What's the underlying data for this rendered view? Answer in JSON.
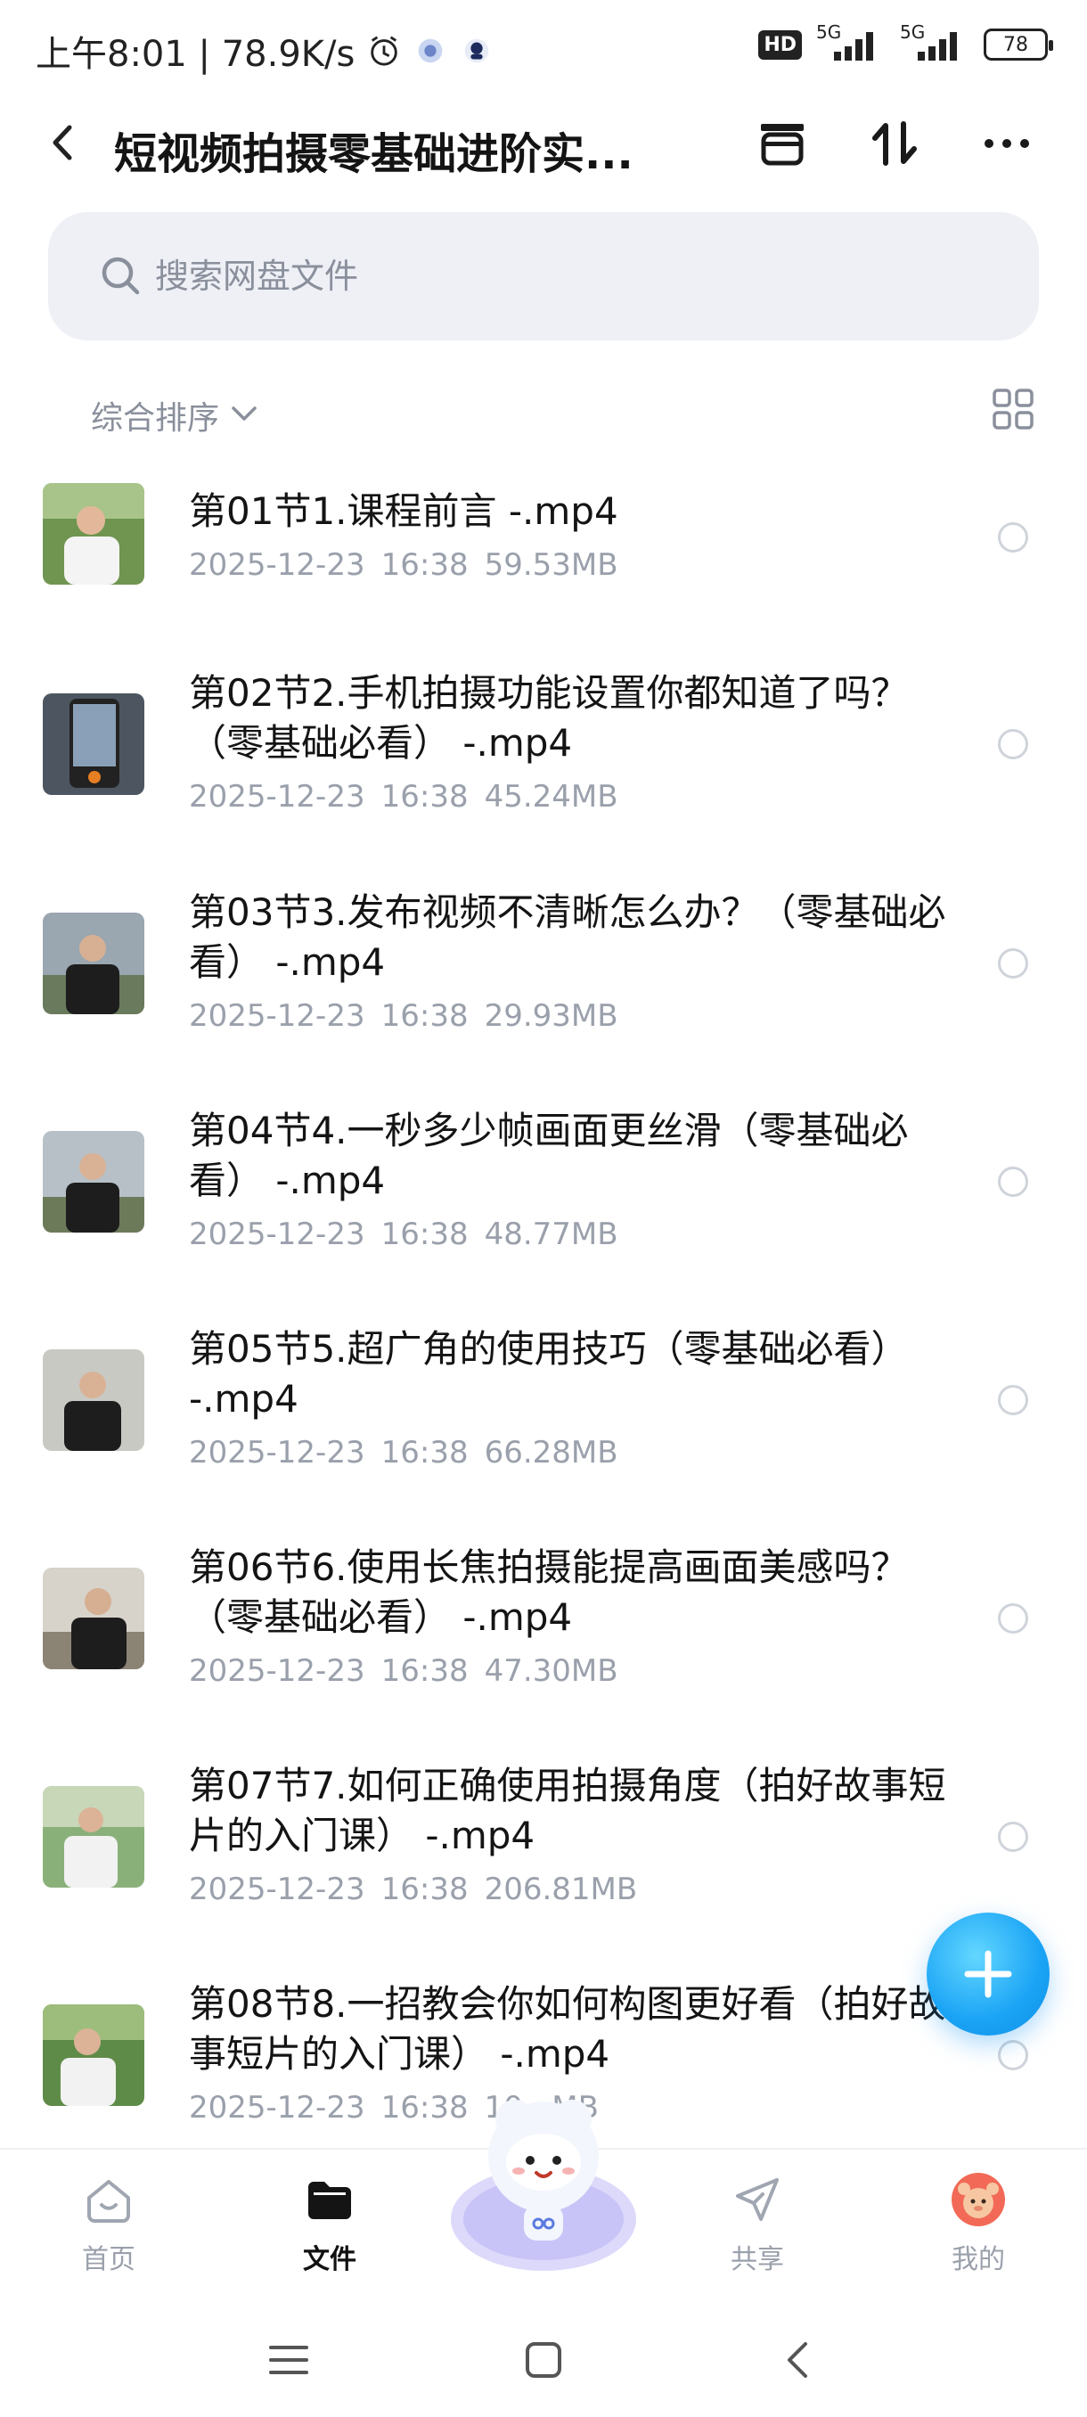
{
  "status_bar": {
    "time_and_speed": "上午8:01 | 78.9K/s",
    "hd_label": "HD",
    "network_1": "5G",
    "network_2": "5G",
    "battery": "78"
  },
  "header": {
    "title": "短视频拍摄零基础进阶实...",
    "back_icon": "chevron-left-icon",
    "archive_icon": "archive-box-icon",
    "sort_icon": "sort-arrows-icon",
    "more_icon": "more-dots-icon"
  },
  "search": {
    "placeholder": "搜索网盘文件"
  },
  "sort": {
    "label": "综合排序"
  },
  "files": [
    {
      "name": "第01节1.课程前言 -.mp4",
      "date": "2025-12-23",
      "time": "16:38",
      "size": "59.53MB"
    },
    {
      "name": "第02节2.手机拍摄功能设置你都知道了吗？（零基础必看） -.mp4",
      "date": "2025-12-23",
      "time": "16:38",
      "size": "45.24MB"
    },
    {
      "name": "第03节3.发布视频不清晰怎么办？（零基础必看） -.mp4",
      "date": "2025-12-23",
      "time": "16:38",
      "size": "29.93MB"
    },
    {
      "name": "第04节4.一秒多少帧画面更丝滑（零基础必看） -.mp4",
      "date": "2025-12-23",
      "time": "16:38",
      "size": "48.77MB"
    },
    {
      "name": "第05节5.超广角的使用技巧（零基础必看） -.mp4",
      "date": "2025-12-23",
      "time": "16:38",
      "size": "66.28MB"
    },
    {
      "name": "第06节6.使用长焦拍摄能提高画面美感吗？（零基础必看） -.mp4",
      "date": "2025-12-23",
      "time": "16:38",
      "size": "47.30MB"
    },
    {
      "name": "第07节7.如何正确使用拍摄角度（拍好故事短片的入门课） -.mp4",
      "date": "2025-12-23",
      "time": "16:38",
      "size": "206.81MB"
    },
    {
      "name": "第08节8.一招教会你如何构图更好看（拍好故事短片的入门课） -.mp4",
      "date": "2025-12-23",
      "time": "16:38",
      "size": "10...MB"
    }
  ],
  "tabs": [
    {
      "label": "首页",
      "icon": "home-icon"
    },
    {
      "label": "文件",
      "icon": "folder-icon"
    },
    {
      "label": "共享",
      "icon": "paper-plane-icon"
    },
    {
      "label": "我的",
      "icon": "avatar-icon"
    }
  ],
  "colors": {
    "accent": "#1aa3f5",
    "search_bg": "#eef0f6",
    "meta_text": "#9aa0ab"
  }
}
